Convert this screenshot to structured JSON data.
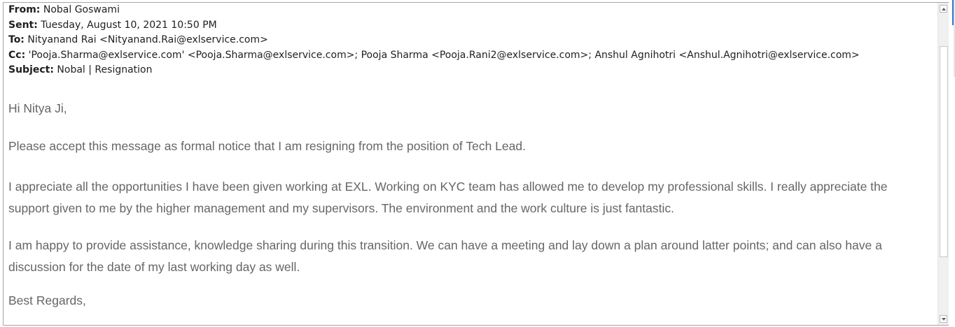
{
  "email": {
    "from_label": "From:",
    "from": "Nobal Goswami",
    "sent_label": "Sent:",
    "sent": "Tuesday, August 10, 2021 10:50 PM",
    "to_label": "To:",
    "to": "Nityanand Rai <Nityanand.Rai@exlservice.com>",
    "cc_label": "Cc:",
    "cc": "'Pooja.Sharma@exlservice.com' <Pooja.Sharma@exlservice.com>; Pooja Sharma <Pooja.Rani2@exlservice.com>; Anshul Agnihotri <Anshul.Agnihotri@exlservice.com>",
    "subject_label": "Subject:",
    "subject": "Nobal | Resignation"
  },
  "body": {
    "greeting": "Hi Nitya Ji,",
    "p1": "Please accept this message as formal notice that I am resigning from the position of Tech Lead.",
    "p2_line1": "I appreciate all the opportunities I have been given working at EXL. Working on KYC team has allowed me to develop my professional skills. I really appreciate the",
    "p2_line2": "support given to me by the higher management and my supervisors. The environment and the work culture is just fantastic.",
    "p3_line1": "I am happy to provide assistance, knowledge sharing during this transition. We can have a meeting and lay down a plan around latter points; and can also have a",
    "p3_line2": "discussion for the date of my last working day as well.",
    "signoff": "Best Regards,"
  },
  "scrollbar": {
    "up_icon": "arrow-up-icon",
    "down_icon": "arrow-down-icon",
    "position": 0.12
  },
  "colors": {
    "header_text": "#1f1f1f",
    "body_text": "#666666",
    "accent": "#2b78d4"
  }
}
